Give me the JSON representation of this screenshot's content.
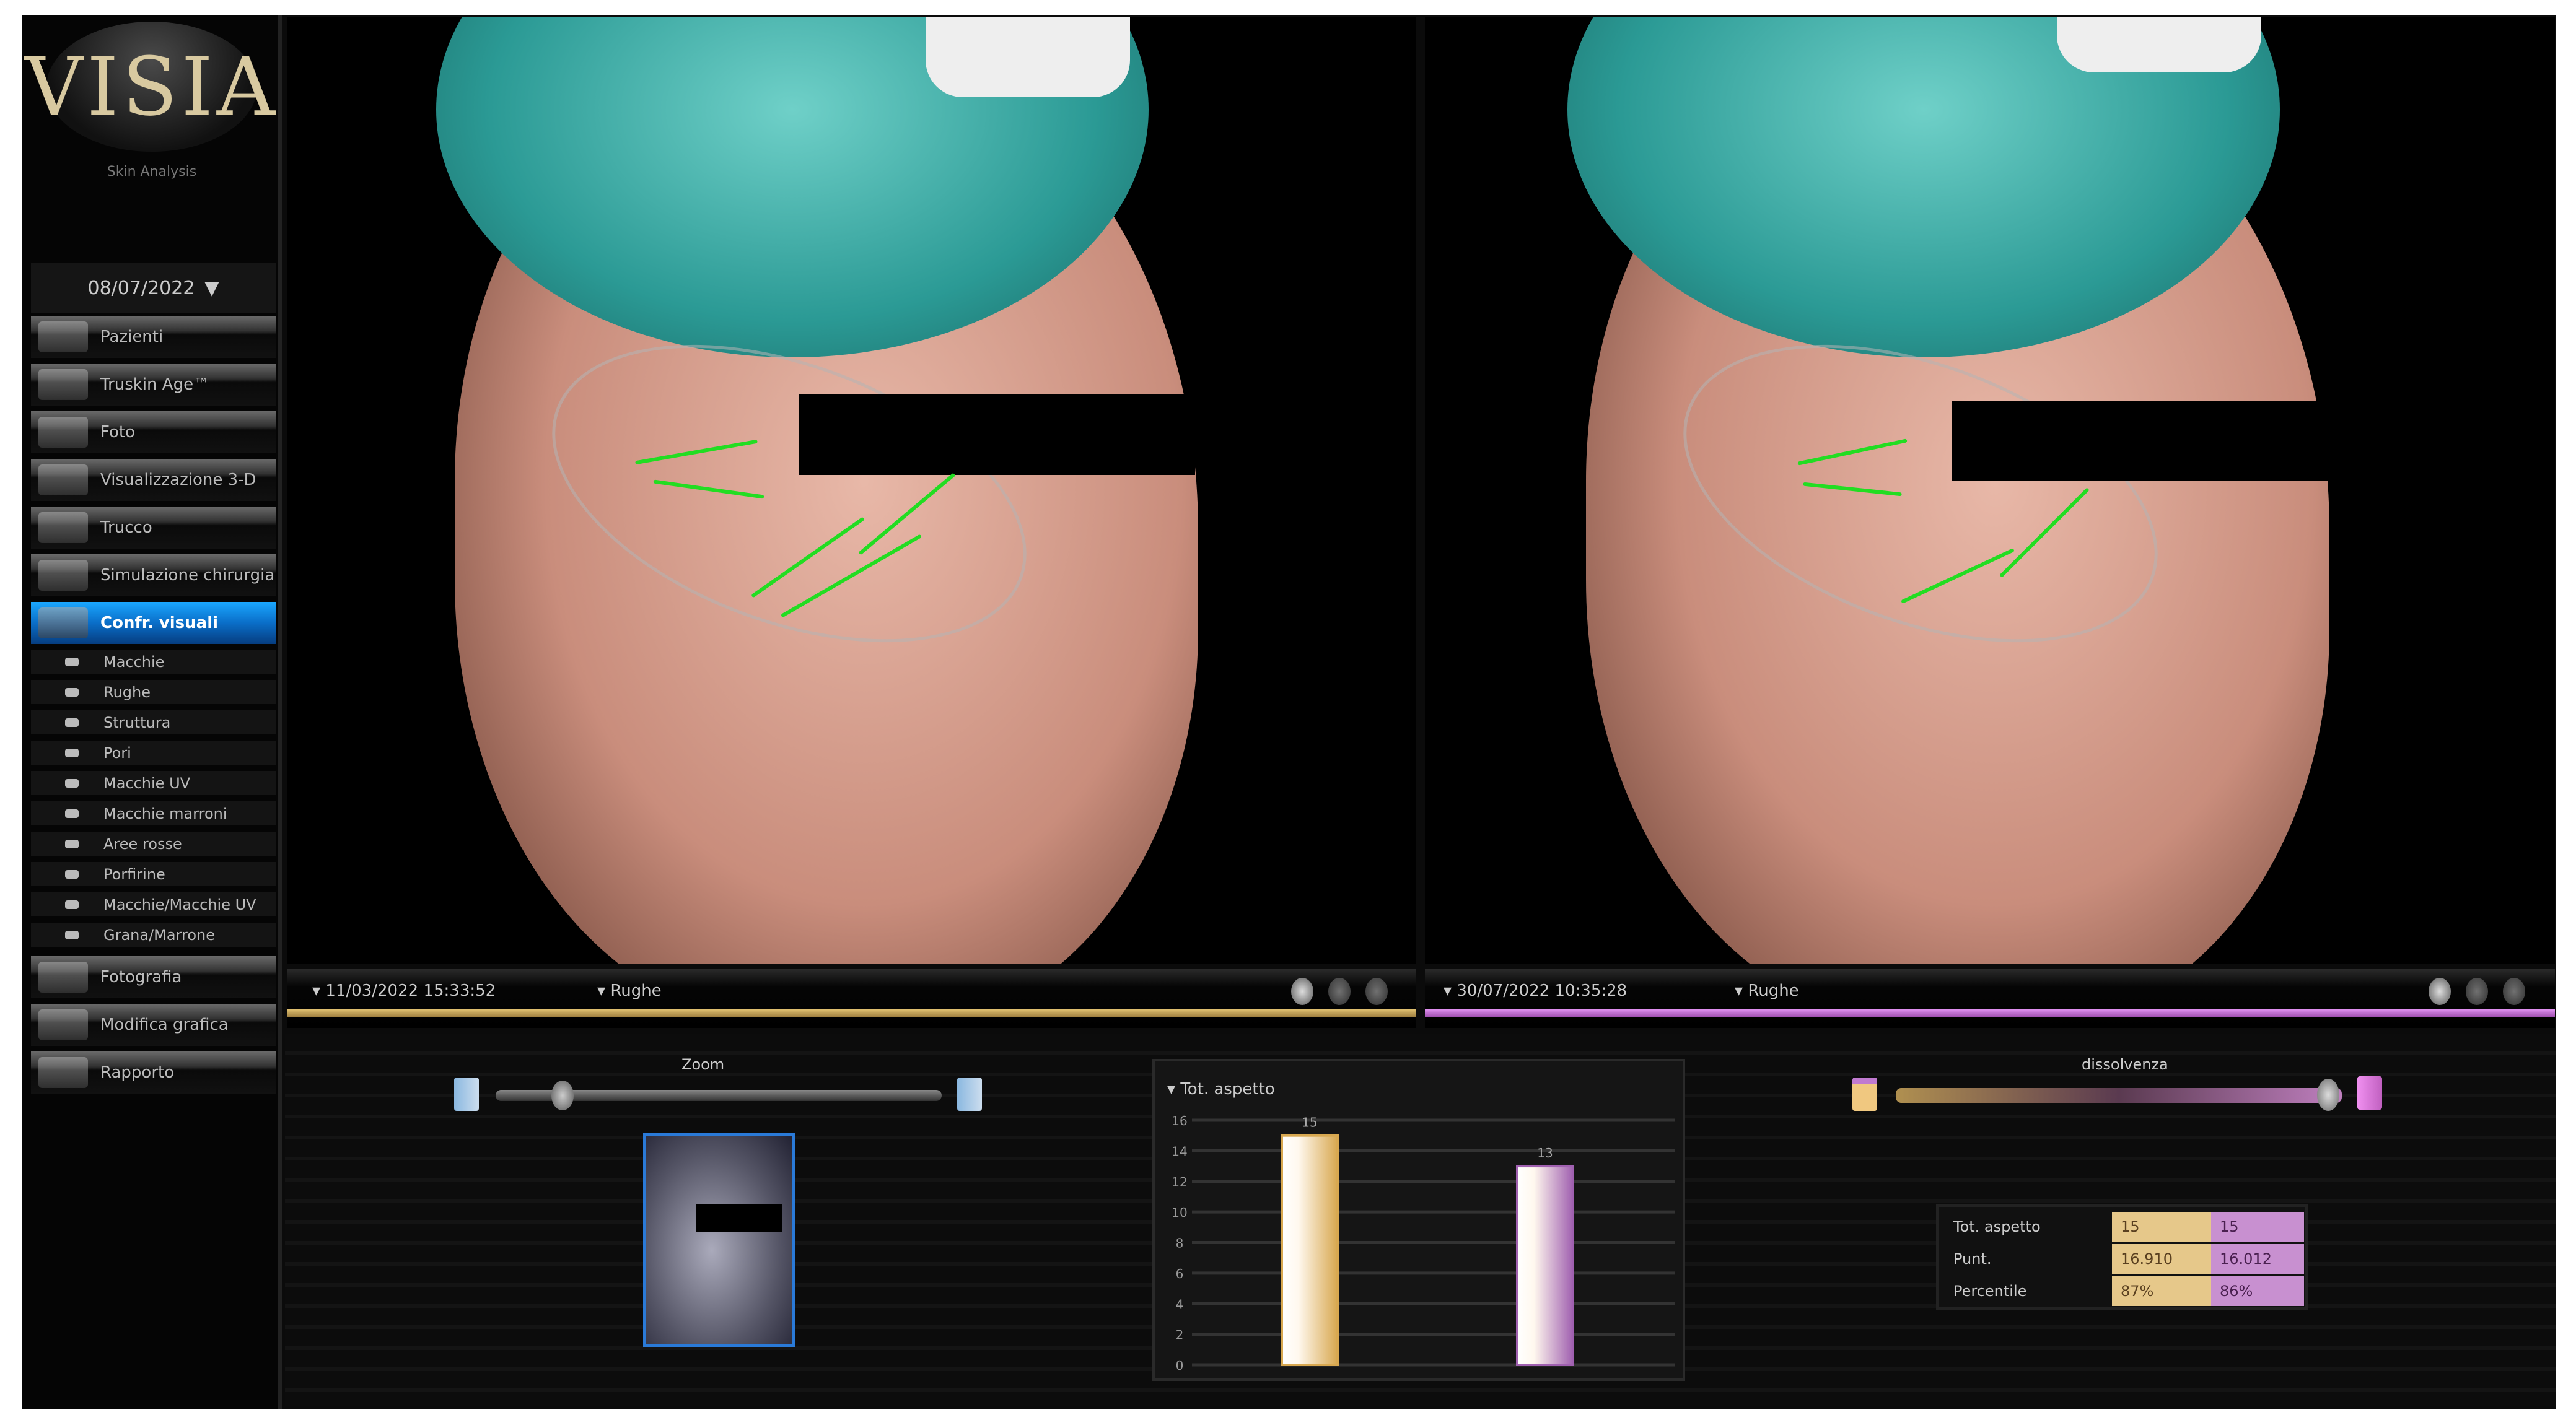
{
  "app": {
    "logo": "VISIA",
    "logo_sub": "Skin Analysis"
  },
  "sidebar": {
    "date": "08/07/2022",
    "nav": [
      {
        "label": "Pazienti"
      },
      {
        "label": "Truskin Age™"
      },
      {
        "label": "Foto"
      },
      {
        "label": "Visualizzazione 3-D"
      },
      {
        "label": "Trucco"
      },
      {
        "label": "Simulazione chirurgia"
      },
      {
        "label": "Confr. visuali"
      }
    ],
    "sub": [
      {
        "label": "Macchie"
      },
      {
        "label": "Rughe"
      },
      {
        "label": "Struttura"
      },
      {
        "label": "Pori"
      },
      {
        "label": "Macchie UV"
      },
      {
        "label": "Macchie marroni"
      },
      {
        "label": "Aree rosse"
      },
      {
        "label": "Porfirine"
      },
      {
        "label": "Macchie/Macchie UV"
      },
      {
        "label": "Grana/Marrone"
      }
    ],
    "nav_bottom": [
      {
        "label": "Fotografia"
      },
      {
        "label": "Modifica grafica"
      },
      {
        "label": "Rapporto"
      }
    ]
  },
  "left_panel": {
    "datetime": "11/03/2022 15:33:52",
    "feature": "Rughe",
    "accent": "#d8b060"
  },
  "right_panel": {
    "datetime": "30/07/2022 10:35:28",
    "feature": "Rughe",
    "accent": "#c07ad0"
  },
  "zoom": {
    "label": "Zoom",
    "value": 0.15
  },
  "dissolve": {
    "label": "dissolvenza",
    "value": 0.97
  },
  "chart_data": {
    "type": "bar",
    "title": "Tot. aspetto",
    "categories": [
      "11/03/2022",
      "30/07/2022"
    ],
    "values": [
      15,
      13
    ],
    "value_labels": [
      "15",
      "13"
    ],
    "colors": [
      "#d8a850",
      "#a060b0"
    ],
    "yticks": [
      "16",
      "14",
      "12",
      "10",
      "8",
      "6",
      "4",
      "2",
      "0"
    ],
    "ylim": [
      0,
      16
    ]
  },
  "table": {
    "rows": [
      {
        "label": "Tot. aspetto",
        "a": "15",
        "b": "15"
      },
      {
        "label": "Punt.",
        "a": "16.910",
        "b": "16.012"
      },
      {
        "label": "Percentile",
        "a": "87%",
        "b": "86%"
      }
    ]
  }
}
